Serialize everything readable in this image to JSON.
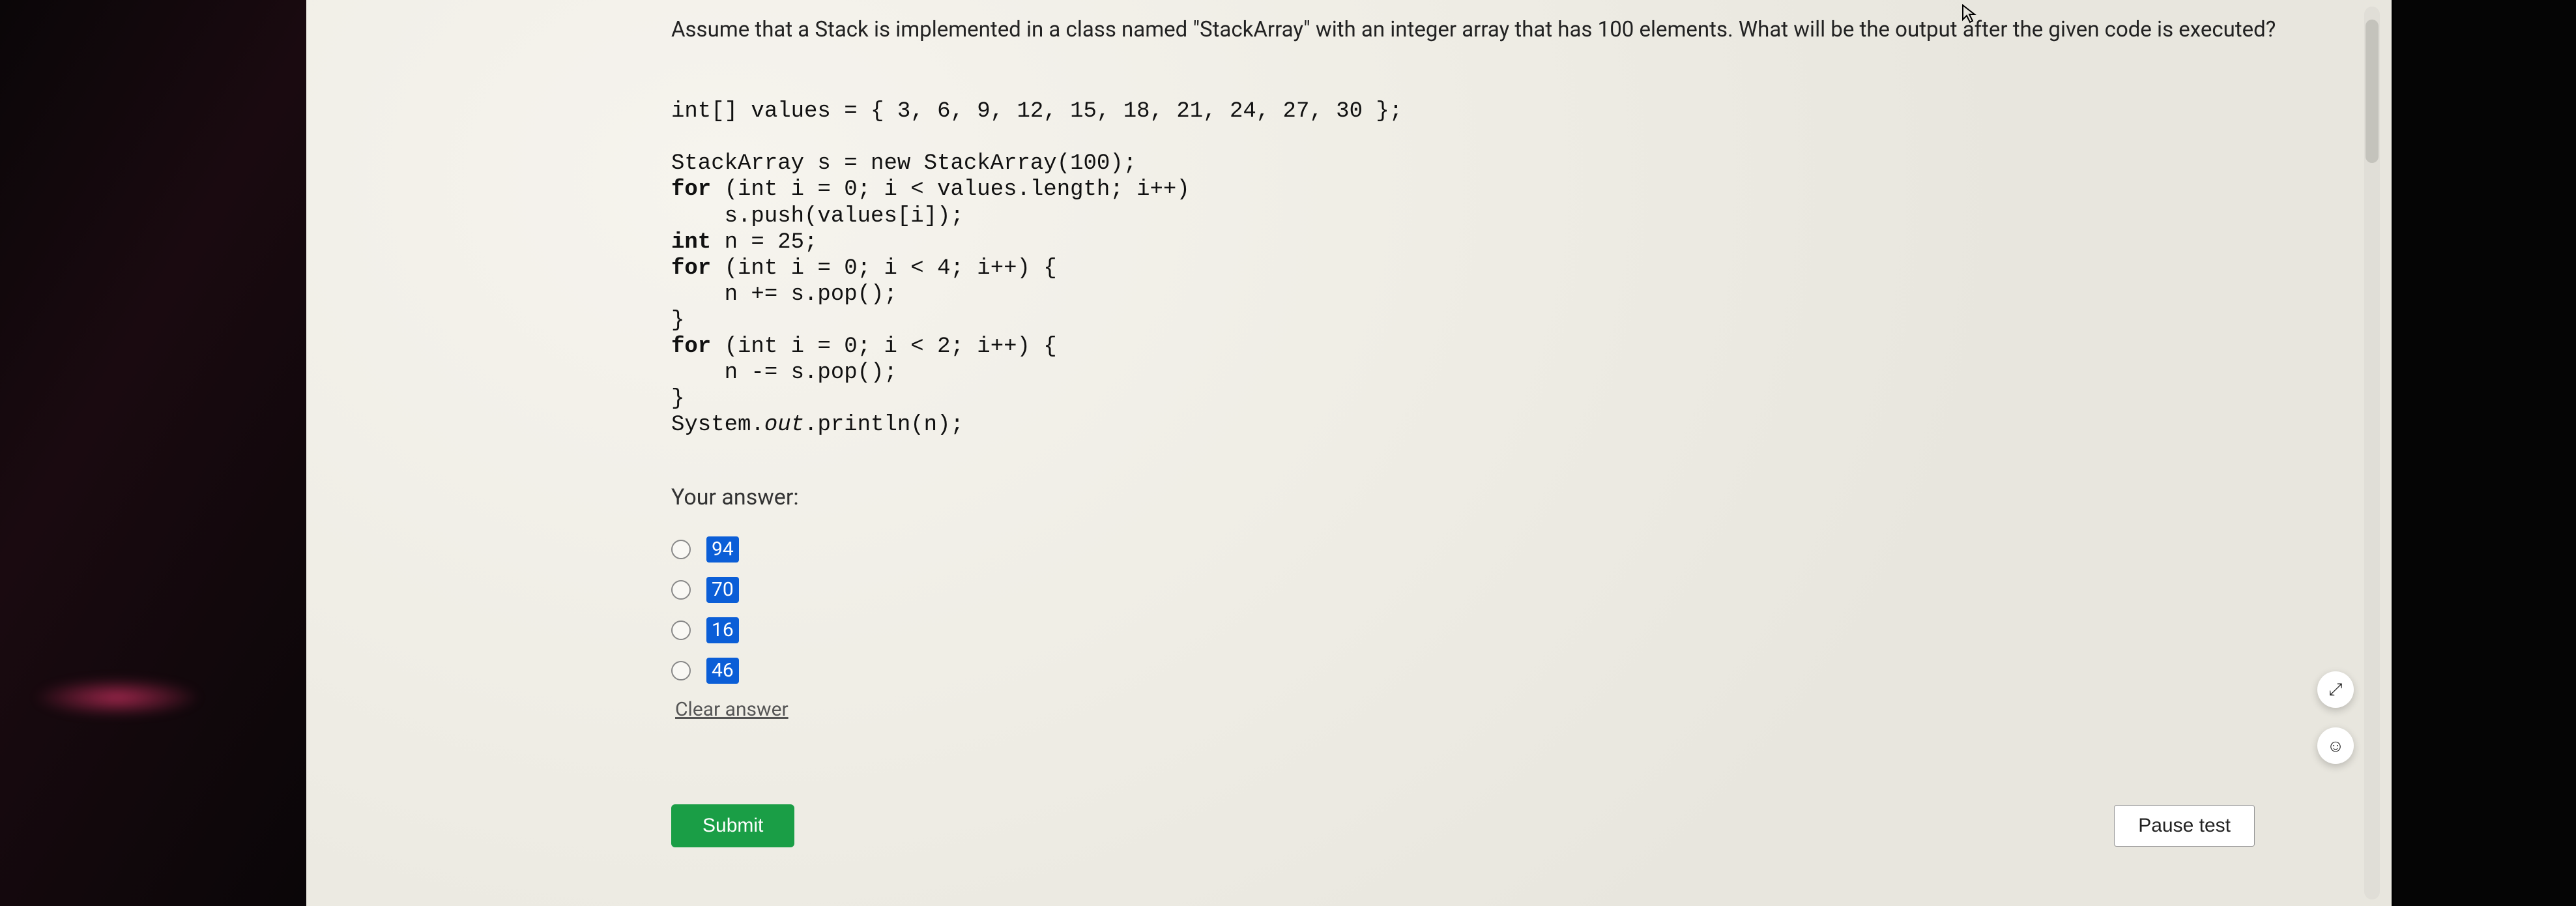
{
  "question": {
    "prompt": "Assume that a Stack is implemented in a class named \"StackArray\" with an integer array that has 100 elements. What will be the output after the given code is executed?",
    "code": {
      "l1": "int[] values = { 3, 6, 9, 12, 15, 18, 21, 24, 27, 30 };",
      "l2": "",
      "l3": "StackArray s = new StackArray(100);",
      "l4a": "for",
      "l4b": " (int i = 0; i < values.length; i++)",
      "l5": "    s.push(values[i]);",
      "l6a": "int",
      "l6b": " n = 25;",
      "l7a": "for",
      "l7b": " (int i = 0; i < 4; i++) {",
      "l8": "    n += s.pop();",
      "l9": "}",
      "l10a": "for",
      "l10b": " (int i = 0; i < 2; i++) {",
      "l11": "    n -= s.pop();",
      "l12": "}",
      "l13a": "System.",
      "l13b": "out",
      "l13c": ".println(n);"
    }
  },
  "answer": {
    "label": "Your answer:",
    "options": [
      "94",
      "70",
      "16",
      "46"
    ],
    "clear": "Clear answer"
  },
  "buttons": {
    "submit": "Submit",
    "pause": "Pause test"
  },
  "fab": {
    "focus": "⤢",
    "face": "☺"
  }
}
